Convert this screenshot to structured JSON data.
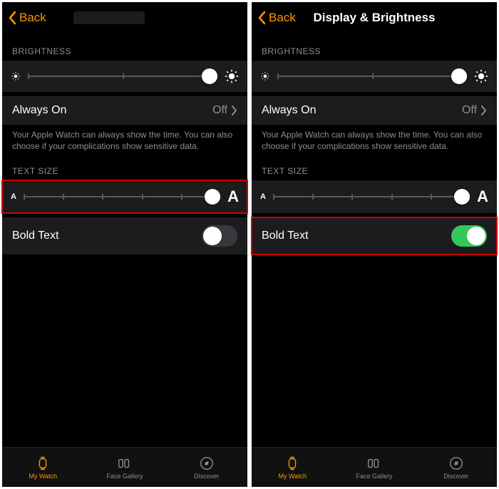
{
  "left": {
    "back": "Back",
    "title": "",
    "brightnessLabel": "BRIGHTNESS",
    "alwaysOn": "Always On",
    "alwaysOnValue": "Off",
    "alwaysOnDesc": "Your Apple Watch can always show the time. You can also choose if your complications show sensitive data.",
    "textSizeLabel": "TEXT SIZE",
    "boldText": "Bold Text"
  },
  "right": {
    "back": "Back",
    "title": "Display & Brightness",
    "brightnessLabel": "BRIGHTNESS",
    "alwaysOn": "Always On",
    "alwaysOnValue": "Off",
    "alwaysOnDesc": "Your Apple Watch can always show the time. You can also choose if your complications show sensitive data.",
    "textSizeLabel": "TEXT SIZE",
    "boldText": "Bold Text"
  },
  "tabs": {
    "myWatch": "My Watch",
    "faceGallery": "Face Gallery",
    "discover": "Discover"
  }
}
